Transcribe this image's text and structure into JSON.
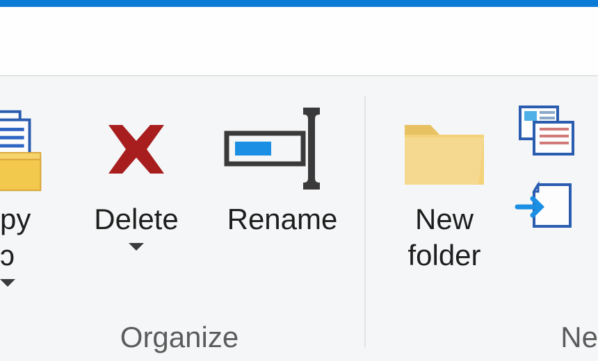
{
  "ribbon": {
    "organize": {
      "copy_to_label": "py\nɔ",
      "delete_label": "Delete",
      "rename_label": "Rename",
      "group_label": "Organize"
    },
    "new": {
      "new_folder_label": "New\nfolder",
      "group_label": "Ne"
    }
  }
}
